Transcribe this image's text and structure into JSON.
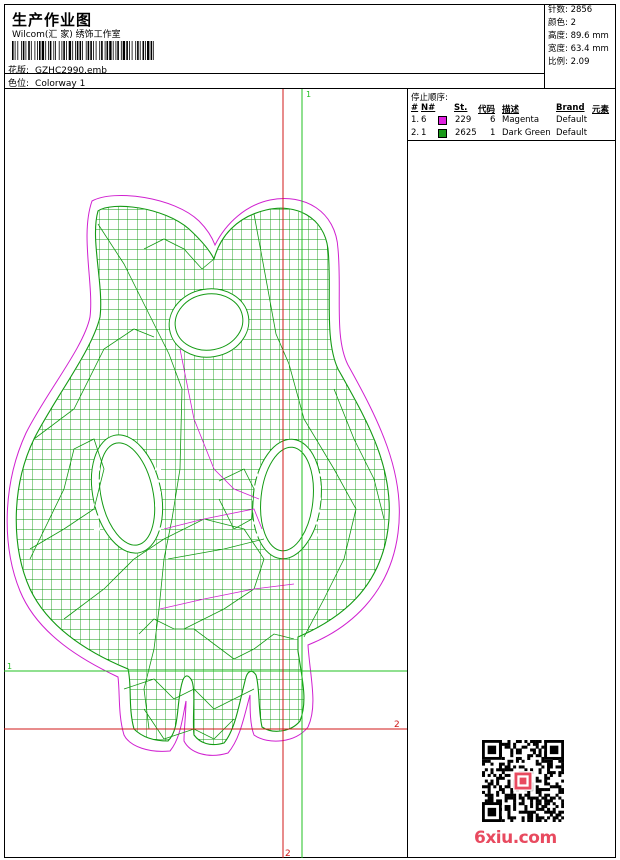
{
  "header": {
    "title": "生产作业图",
    "subtitle": "Wilcom(汇 家) 绣饰工作室",
    "design_label": "花版:",
    "design_value": "GZHC2990.emb",
    "color_label": "色位:",
    "color_value": "Colorway 1"
  },
  "stats": {
    "stitches": "针数: 2856",
    "colors": "颜色: 2",
    "height": "高度: 89.6 mm",
    "width": "宽度: 63.4 mm",
    "scale": "比例: 2.09"
  },
  "stop_sequence": {
    "title": "停止顺序:",
    "headers": {
      "num": "#",
      "no": "N#",
      "st": "St.",
      "code": "代码",
      "desc": "描述",
      "brand": "Brand",
      "extra": "元素"
    },
    "rows": [
      {
        "num": "1.",
        "no": "6",
        "color": "#e020e0",
        "st": "229",
        "code": "6",
        "desc": "Magenta",
        "brand": "Default"
      },
      {
        "num": "2.",
        "no": "1",
        "color": "#1a9a1a",
        "st": "2625",
        "code": "1",
        "desc": "Dark Green",
        "brand": "Default"
      }
    ]
  },
  "guides": {
    "v1_label": "1",
    "h1_label": "1",
    "h2_label": "2",
    "v2_label": "2"
  },
  "colors": {
    "green": "#139a13",
    "magenta": "#d020d0",
    "red_guide": "#d01818",
    "green_guide": "#22c022"
  },
  "watermark": {
    "site": "6xiu.com"
  }
}
